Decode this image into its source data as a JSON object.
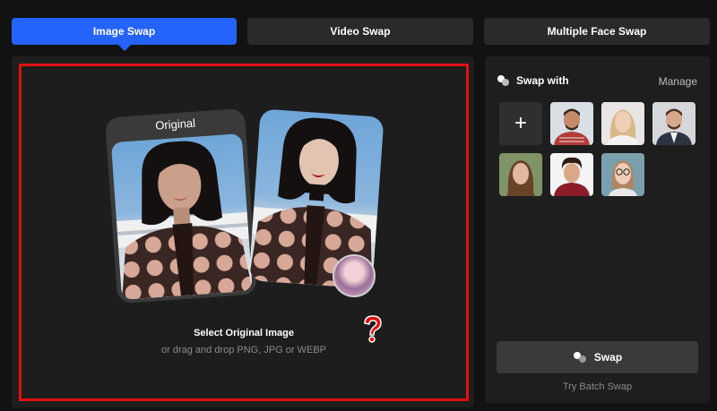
{
  "tabs": [
    {
      "label": "Image Swap",
      "active": true
    },
    {
      "label": "Video Swap",
      "active": false
    },
    {
      "label": "Multiple Face Swap",
      "active": false
    }
  ],
  "upload": {
    "card_label": "Original",
    "title": "Select Original Image",
    "subtitle": "or drag and drop PNG, JPG or WEBP"
  },
  "sidebar": {
    "swap_with_label": "Swap with",
    "manage_label": "Manage",
    "add_face_symbol": "+",
    "faces": [
      {
        "name": "face-man-checkered-shirt"
      },
      {
        "name": "face-woman-blonde"
      },
      {
        "name": "face-man-suit"
      },
      {
        "name": "face-woman-brown-hair"
      },
      {
        "name": "face-man-curly-hair"
      },
      {
        "name": "face-woman-glasses"
      }
    ],
    "swap_button_label": "Swap",
    "batch_link_label": "Try Batch Swap"
  },
  "colors": {
    "accent": "#2563ff",
    "highlight_border": "#e01010",
    "question_mark": "#e01010"
  },
  "icons": [
    "plus-icon",
    "swap-with-icon",
    "swap-icon",
    "question-mark-icon"
  ]
}
